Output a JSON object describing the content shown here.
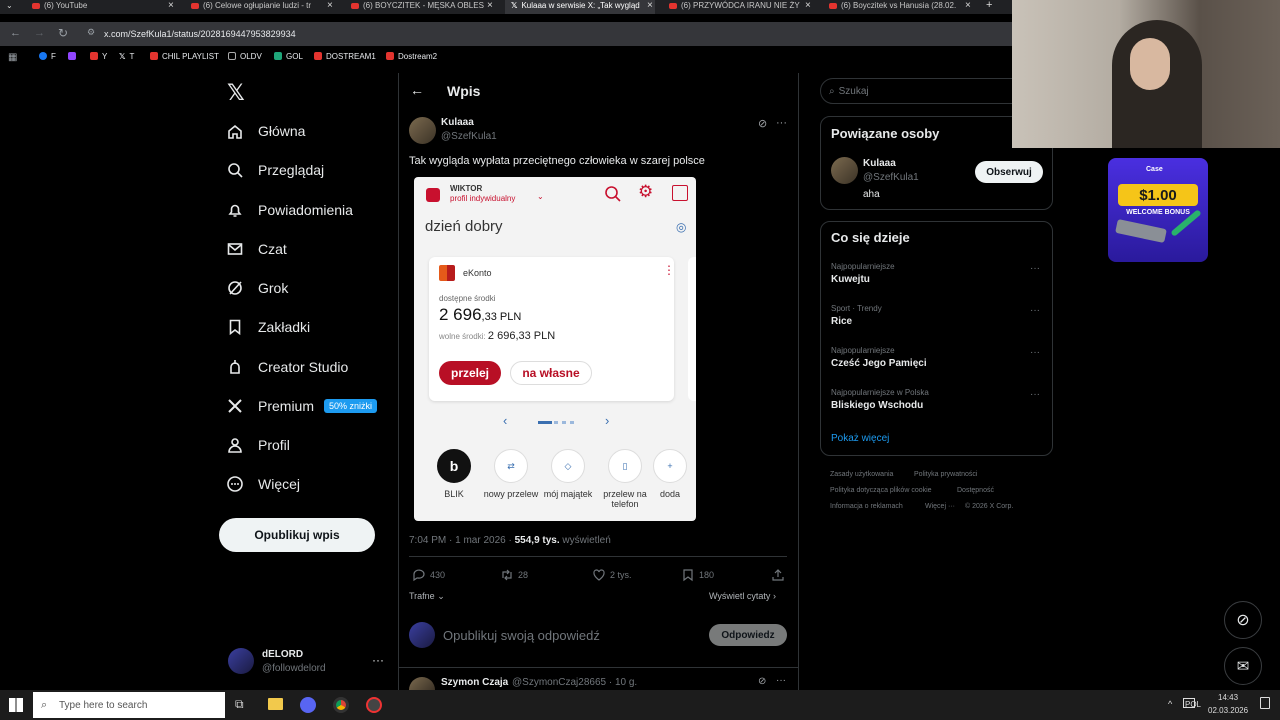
{
  "browser": {
    "tabs": [
      {
        "label": "(6) YouTube",
        "type": "yt"
      },
      {
        "label": "(6) Celowe ogłupianie ludzi - tr",
        "type": "yt"
      },
      {
        "label": "(6) BOYCZITEK - MĘSKA OBLES",
        "type": "yt"
      },
      {
        "label": "Kulaaa w serwisie X: „Tak wygląd",
        "type": "x",
        "active": true
      },
      {
        "label": "(6) PRZYWÓDCA IRANU NIE ŻY",
        "type": "yt"
      },
      {
        "label": "(6) Boyczitek vs Hanusia (28.02.",
        "type": "yt"
      }
    ],
    "url": "x.com/SzefKula1/status/2028169447953829934",
    "bookmarks": [
      "F",
      "",
      "Y",
      "T",
      "CHIL PLAYLIST",
      "OLDV",
      "GOL",
      "DOSTREAM1",
      "Dostream2"
    ]
  },
  "nav": {
    "items": [
      {
        "label": "Główna",
        "icon": "home-icon"
      },
      {
        "label": "Przeglądaj",
        "icon": "search-icon"
      },
      {
        "label": "Powiadomienia",
        "icon": "bell-icon"
      },
      {
        "label": "Czat",
        "icon": "mail-icon"
      },
      {
        "label": "Grok",
        "icon": "grok-icon"
      },
      {
        "label": "Zakładki",
        "icon": "bookmark-icon"
      },
      {
        "label": "Creator Studio",
        "icon": "creator-icon"
      },
      {
        "label": "Premium",
        "icon": "x-logo-icon",
        "badge": "50% zniżki"
      },
      {
        "label": "Profil",
        "icon": "profile-icon"
      },
      {
        "label": "Więcej",
        "icon": "more-icon"
      }
    ],
    "post_button": "Opublikuj wpis",
    "account": {
      "name": "dELORD",
      "handle": "@followdelord"
    }
  },
  "post": {
    "header_title": "Wpis",
    "author": {
      "name": "Kulaaa",
      "handle": "@SzefKula1"
    },
    "text": "Tak wygląda wypłata przeciętnego człowieka w szarej polsce",
    "meta": {
      "time": "7:04 PM · 1 mar 2026 · ",
      "views": "554,9 tys.",
      "views_label": " wyświetleń"
    },
    "actions": {
      "replies": "430",
      "reposts": "28",
      "likes": "2 tys.",
      "bookmarks": "180"
    },
    "sort_label": "Trafne",
    "quotes_label": "Wyświetl cytaty",
    "reply_placeholder": "Opublikuj swoją odpowiedź",
    "reply_button": "Odpowiedz",
    "next_reply": {
      "name": "Szymon Czaja",
      "handle": "@SzymonCzaj28665 · 10 g."
    }
  },
  "bank": {
    "user": "WIKTOR",
    "profile": "profil indywidualny",
    "greeting": "dzień dobry",
    "account_name": "eKonto",
    "available_label": "dostępne środki",
    "balance_main": "2 696",
    "balance_frac": ",33 PLN",
    "free_label": "wolne środki: ",
    "free_value": "2 696,33 PLN",
    "btn_transfer": "przelej",
    "btn_own": "na własne",
    "quick": [
      "BLIK",
      "nowy przelew",
      "mój majątek",
      "przelew na telefon",
      "doda"
    ],
    "brand_red": "#c8102e"
  },
  "sidebar": {
    "search_placeholder": "Szukaj",
    "related_title": "Powiązane osoby",
    "related": {
      "name": "Kulaaa",
      "handle": "@SzefKula1",
      "bio": "aha",
      "follow": "Obserwuj"
    },
    "trends_title": "Co się dzieje",
    "trends": [
      {
        "cat": "Najpopularniejsze",
        "name": "Kuwejtu"
      },
      {
        "cat": "Sport · Trendy",
        "name": "Rice"
      },
      {
        "cat": "Najpopularniejsze",
        "name": "Cześć Jego Pamięci"
      },
      {
        "cat": "Najpopularniejsze w Polska",
        "name": "Bliskiego Wschodu"
      }
    ],
    "show_more": "Pokaż więcej",
    "footer": [
      "Zasady użytkowania",
      "Polityka prywatności",
      "Polityka dotycząca plików cookie",
      "Dostępność",
      "Informacja o reklamach",
      "Więcej ···",
      "© 2026 X Corp."
    ]
  },
  "ad": {
    "top": "Case",
    "amount": "$1.00",
    "label": "WELCOME BONUS"
  },
  "taskbar": {
    "search": "Type here to search",
    "lang": "POL",
    "time": "14:43",
    "date": "02.03.2026"
  }
}
